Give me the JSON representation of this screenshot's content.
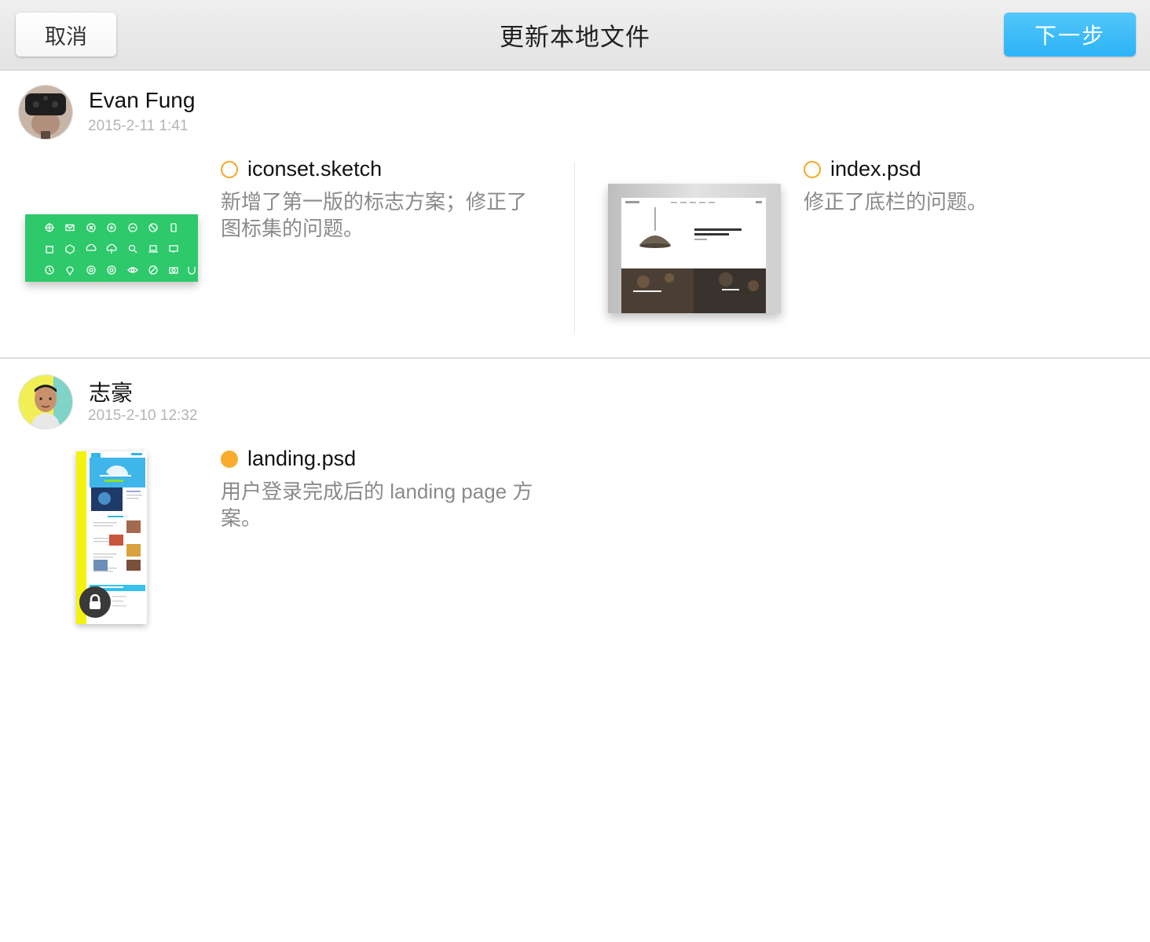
{
  "header": {
    "cancel_label": "取消",
    "title": "更新本地文件",
    "next_label": "下一步"
  },
  "colors": {
    "accent_blue": "#2db3f6",
    "status_orange": "#f8ab2c",
    "thumb_green": "#2dc96a",
    "muted_text": "#8a8a8a"
  },
  "updates": [
    {
      "user": "Evan Fung",
      "time": "2015-2-11 1:41",
      "files": [
        {
          "name": "iconset.sketch",
          "desc": "新增了第一版的标志方案；修正了图标集的问题。",
          "status": "outline"
        },
        {
          "name": "index.psd",
          "desc": "修正了底栏的问题。",
          "status": "outline"
        }
      ]
    },
    {
      "user": "志豪",
      "time": "2015-2-10 12:32",
      "files": [
        {
          "name": "landing.psd",
          "desc": "用户登录完成后的 landing page 方案。",
          "status": "filled",
          "locked": true
        }
      ]
    }
  ],
  "icons": [
    "lock-icon",
    "status-outline-icon",
    "status-filled-icon"
  ]
}
